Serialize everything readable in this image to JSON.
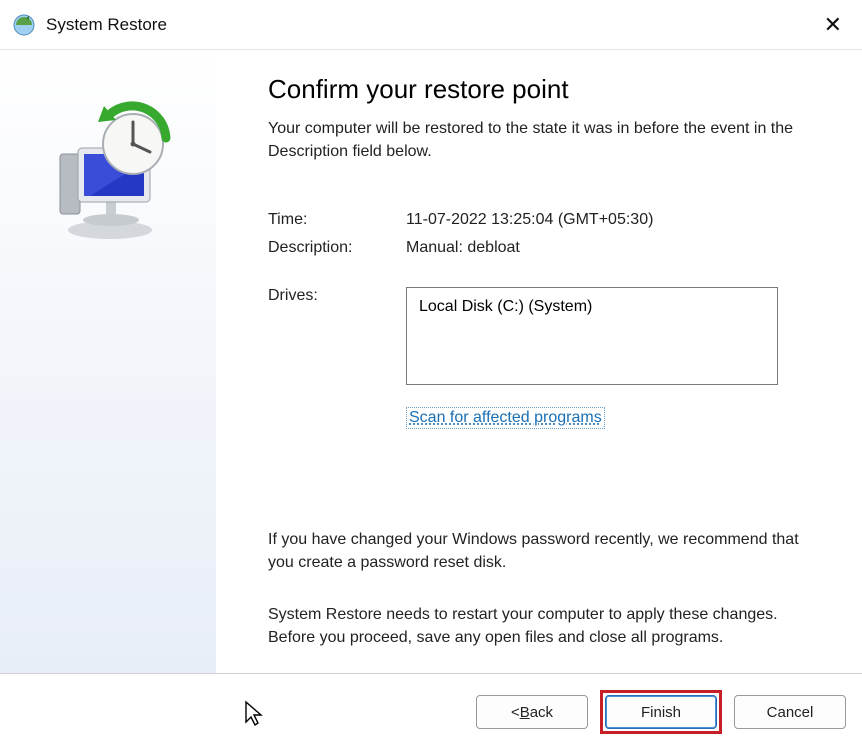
{
  "titlebar": {
    "title": "System Restore"
  },
  "content": {
    "heading": "Confirm your restore point",
    "intro": "Your computer will be restored to the state it was in before the event in the Description field below.",
    "time_label": "Time:",
    "time_value": "11-07-2022 13:25:04 (GMT+05:30)",
    "description_label": "Description:",
    "description_value": "Manual: debloat",
    "drives_label": "Drives:",
    "drives_value": "Local Disk (C:) (System)",
    "scan_link": "Scan for affected programs",
    "note1": "If you have changed your Windows password recently, we recommend that you create a password reset disk.",
    "note2": "System Restore needs to restart your computer to apply these changes. Before you proceed, save any open files and close all programs."
  },
  "footer": {
    "back": "Back",
    "back_prefix": "< ",
    "finish": "Finish",
    "cancel": "Cancel"
  }
}
